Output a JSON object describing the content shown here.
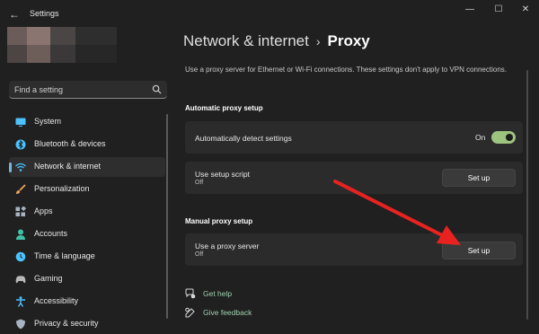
{
  "window": {
    "title": "Settings",
    "back_icon": "back-arrow-icon",
    "controls": {
      "minimize": "—",
      "maximize": "☐",
      "close": "✕"
    }
  },
  "user": {
    "avatar": "blurred-profile-image"
  },
  "search": {
    "placeholder": "Find a setting",
    "icon": "search-icon"
  },
  "sidebar": {
    "items": [
      {
        "label": "System",
        "icon": "monitor-icon",
        "color": "#4cc2ff"
      },
      {
        "label": "Bluetooth & devices",
        "icon": "bluetooth-icon",
        "color": "#4cc2ff"
      },
      {
        "label": "Network & internet",
        "icon": "wifi-icon",
        "color": "#4cc2ff",
        "active": true
      },
      {
        "label": "Personalization",
        "icon": "brush-icon",
        "color": "#f0a35a"
      },
      {
        "label": "Apps",
        "icon": "apps-icon",
        "color": "#a7b3c2"
      },
      {
        "label": "Accounts",
        "icon": "person-icon",
        "color": "#3fc1a8"
      },
      {
        "label": "Time & language",
        "icon": "globe-clock-icon",
        "color": "#4cc2ff"
      },
      {
        "label": "Gaming",
        "icon": "gamepad-icon",
        "color": "#b8b8b8"
      },
      {
        "label": "Accessibility",
        "icon": "accessibility-icon",
        "color": "#4cc2ff"
      },
      {
        "label": "Privacy & security",
        "icon": "shield-icon",
        "color": "#a7b3c2"
      }
    ]
  },
  "breadcrumb": {
    "parent": "Network & internet",
    "separator": "›",
    "current": "Proxy"
  },
  "description": "Use a proxy server for Ethernet or Wi-Fi connections. These settings don't apply to VPN connections.",
  "automatic": {
    "heading": "Automatic proxy setup",
    "detect": {
      "title": "Automatically detect settings",
      "state_label": "On",
      "enabled": true
    },
    "script": {
      "title": "Use setup script",
      "status": "Off",
      "button": "Set up"
    }
  },
  "manual": {
    "heading": "Manual proxy setup",
    "proxy": {
      "title": "Use a proxy server",
      "status": "Off",
      "button": "Set up"
    }
  },
  "links": [
    {
      "label": "Get help",
      "icon": "help-icon"
    },
    {
      "label": "Give feedback",
      "icon": "feedback-icon"
    }
  ],
  "annotation": {
    "type": "red-arrow",
    "color": "#e8231f",
    "points_to": "manual-proxy-setup-button"
  },
  "colors": {
    "background": "#202020",
    "card": "#2b2b2b",
    "accent": "#9cc47e",
    "link": "#9fd1b0",
    "nav_indicator": "#7ab4d8"
  }
}
